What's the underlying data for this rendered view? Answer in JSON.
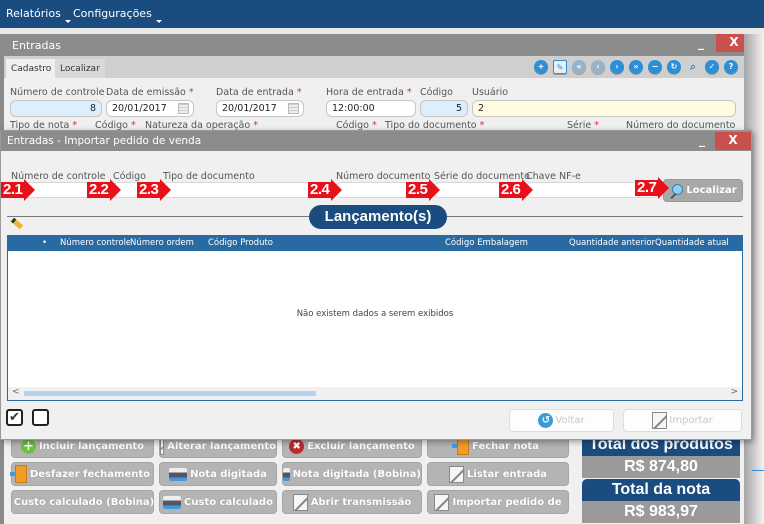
{
  "menu": {
    "items": [
      {
        "label": "Relatórios"
      },
      {
        "label": "Configurações"
      }
    ]
  },
  "main_window": {
    "title": "Entradas",
    "minimize_label": "_",
    "close_label": "X",
    "tabs": [
      {
        "label": "Cadastro",
        "active": true
      },
      {
        "label": "Localizar",
        "active": false
      }
    ],
    "toolbar_icons": [
      "add-icon",
      "edit-icon",
      "first-record-icon",
      "previous-record-icon",
      "next-record-icon",
      "last-record-icon",
      "remove-icon",
      "refresh-icon",
      "search-icon",
      "confirm-icon",
      "help-icon"
    ],
    "toolbar_glyphs": [
      "+",
      "✎",
      "«",
      "‹",
      "›",
      "»",
      "−",
      "↻",
      "⌕",
      "✓",
      "?"
    ],
    "fields": {
      "numero_controle": {
        "label": "Número de controle",
        "value": "8"
      },
      "data_emissao": {
        "label": "Data de emissão",
        "required": "*",
        "value": "20/01/2017"
      },
      "data_entrada": {
        "label": "Data de entrada",
        "required": "*",
        "value": "20/01/2017"
      },
      "hora_entrada": {
        "label": "Hora de entrada",
        "required": "*",
        "value": "12:00:00"
      },
      "codigo": {
        "label": "Código",
        "value": "5"
      },
      "usuario": {
        "label": "Usuário",
        "value": "2"
      }
    },
    "row2_labels": {
      "tipo_nota": "Tipo de nota",
      "codigo1": "Código",
      "natureza": "Natureza da operação",
      "codigo2": "Código",
      "tipo_documento": "Tipo do documento",
      "serie": "Série",
      "numero_documento": "Número do documento",
      "required": "*"
    },
    "actions": [
      {
        "label": "Incluir lançamento",
        "icon": "plus-icon"
      },
      {
        "label": "Alterar lançamento",
        "icon": "document-edit-icon"
      },
      {
        "label": "Excluir lançamento",
        "icon": "delete-icon"
      },
      {
        "label": "Fechar nota",
        "icon": "door-icon"
      },
      {
        "label": "Desfazer fechamento",
        "icon": "door-icon"
      },
      {
        "label": "Nota digitada",
        "icon": "printer-icon"
      },
      {
        "label": "Nota digitada (Bobina)",
        "icon": "printer-icon"
      },
      {
        "label": "Listar entrada",
        "icon": "document-edit-icon"
      },
      {
        "label": "Custo calculado (Bobina)",
        "icon": "printer-icon"
      },
      {
        "label": "Custo calculado",
        "icon": "printer-icon"
      },
      {
        "label": "Abrir transmissão",
        "icon": "document-edit-icon"
      },
      {
        "label": "Importar pedido de",
        "icon": "document-edit-icon"
      }
    ],
    "totals": {
      "produtos_title": "Total dos produtos",
      "produtos_value": "R$ 874,80",
      "nota_title": "Total da nota",
      "nota_value": "R$ 983,97"
    }
  },
  "modal": {
    "title": "Entradas - Importar pedido de venda",
    "minimize_label": "_",
    "close_label": "X",
    "filters": [
      {
        "label": "Número de controle",
        "value": "",
        "marker": "2.1"
      },
      {
        "label": "Código",
        "value": "",
        "marker": "2.2"
      },
      {
        "label": "Tipo de documento",
        "value": "",
        "marker": "2.3"
      },
      {
        "label": "Número documento",
        "value": "",
        "marker": "2.4"
      },
      {
        "label": "Série do documento",
        "value": "",
        "marker": "2.5"
      },
      {
        "label": "Chave NF-e",
        "value": "",
        "marker": "2.6"
      }
    ],
    "search_button": {
      "label": "Localizar",
      "marker": "2.7"
    },
    "section_title": "Lançamento(s)",
    "grid": {
      "columns": [
        "•",
        "Número controle",
        "Número ordem",
        "Código Produto",
        "Código Embalagem",
        "Quantidade anterior",
        "Quantidade atual"
      ],
      "empty_message": "Não existem dados a serem exibidos",
      "scroll_left": "<",
      "scroll_right": ">"
    },
    "select_all_glyph": "✔",
    "buttons": {
      "voltar": "Voltar",
      "importar": "Importar"
    }
  }
}
